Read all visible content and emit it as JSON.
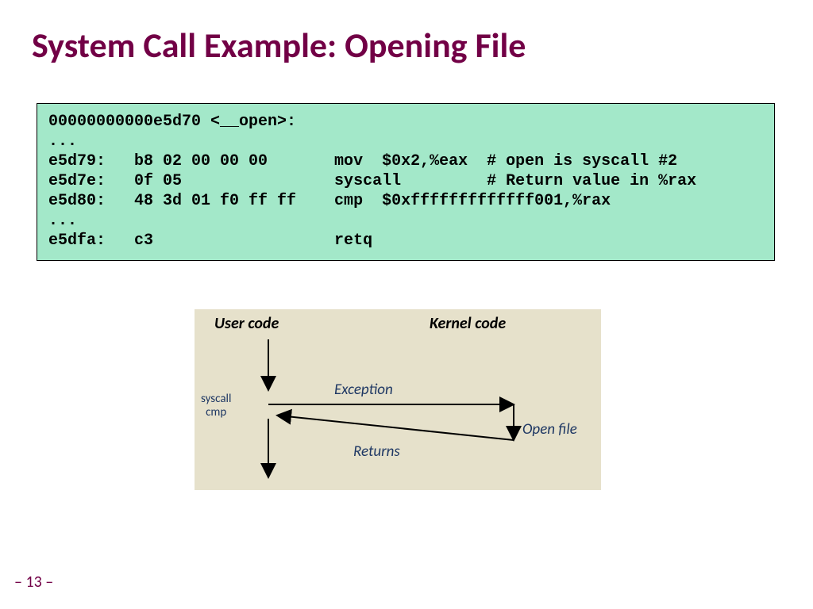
{
  "title": "System Call Example: Opening File",
  "code": {
    "l1": "00000000000e5d70 <__open>:",
    "l2": "...",
    "l3": "e5d79:   b8 02 00 00 00       mov  $0x2,%eax  # open is syscall #2",
    "l4": "e5d7e:   0f 05                syscall         # Return value in %rax",
    "l5": "e5d80:   48 3d 01 f0 ff ff    cmp  $0xfffffffffffff001,%rax",
    "l6": "...",
    "l7": "e5dfa:   c3                   retq"
  },
  "diagram": {
    "user_header": "User code",
    "kernel_header": "Kernel code",
    "syscall_top": "syscall",
    "syscall_bot": "cmp",
    "exception": "Exception",
    "openfile": "Open file",
    "returns": "Returns"
  },
  "page": "– 13 –"
}
